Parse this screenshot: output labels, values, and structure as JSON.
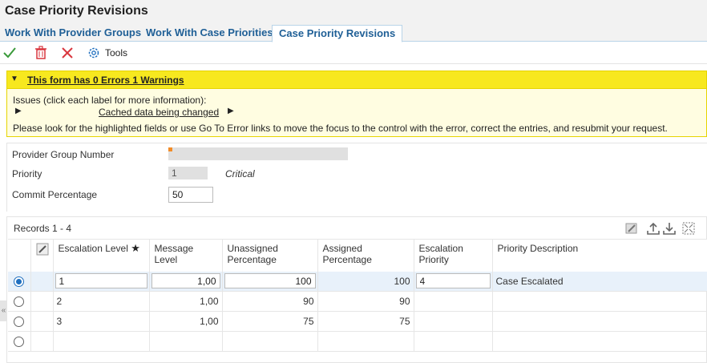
{
  "window": {
    "title": "Case Priority Revisions"
  },
  "tabs": [
    {
      "label": "Work With Provider Groups"
    },
    {
      "label": "Work With Case Priorities"
    },
    {
      "label": "Case Priority Revisions"
    }
  ],
  "toolbar": {
    "tools_label": "Tools",
    "tools_mnemonic": "T"
  },
  "warning": {
    "header": "This form has 0 Errors 1 Warnings",
    "issues_label": "Issues (click each label for more information):",
    "issue_link": "Cached data being changed",
    "message": "Please look for the highlighted fields or use Go To Error links to move the focus to the control with the error, correct the entries, and resubmit your request."
  },
  "form": {
    "provider_group_label": "Provider Group Number",
    "provider_group_value": "",
    "priority_label": "Priority",
    "priority_value": "1",
    "priority_description": "Critical",
    "commit_label": "Commit Percentage",
    "commit_value": "50"
  },
  "grid": {
    "records_label": "Records 1 - 4",
    "columns": [
      "Escalation Level",
      "Message Level",
      "Unassigned Percentage",
      "Assigned Percentage",
      "Escalation Priority",
      "Priority Description"
    ],
    "required_marker": "★",
    "rows": [
      {
        "escalation_level": "1",
        "message_level": "1,00",
        "unassigned": "100",
        "assigned": "100",
        "escalation_priority": "4",
        "priority_description": "Case Escalated",
        "selected": true
      },
      {
        "escalation_level": "2",
        "message_level": "1,00",
        "unassigned": "90",
        "assigned": "90",
        "escalation_priority": "",
        "priority_description": "",
        "selected": false
      },
      {
        "escalation_level": "3",
        "message_level": "1,00",
        "unassigned": "75",
        "assigned": "75",
        "escalation_priority": "",
        "priority_description": "",
        "selected": false
      },
      {
        "escalation_level": "",
        "message_level": "",
        "unassigned": "",
        "assigned": "",
        "escalation_priority": "",
        "priority_description": "",
        "selected": false
      }
    ]
  },
  "icons": {
    "ok": "checkmark-icon",
    "delete": "trash-icon",
    "cancel": "close-icon",
    "tools": "gear-icon",
    "grid_edit": "edit-icon",
    "export": "upload-icon",
    "import": "download-icon",
    "fullscreen": "expand-icon"
  },
  "colors": {
    "accent": "#1f5f96",
    "warning_bar": "#f7e81f",
    "warning_body": "#fffde1",
    "ok_green": "#3a9a3a",
    "cancel_red": "#d9363e",
    "selected_row": "#e8f1fa",
    "required": "#f28c28"
  }
}
